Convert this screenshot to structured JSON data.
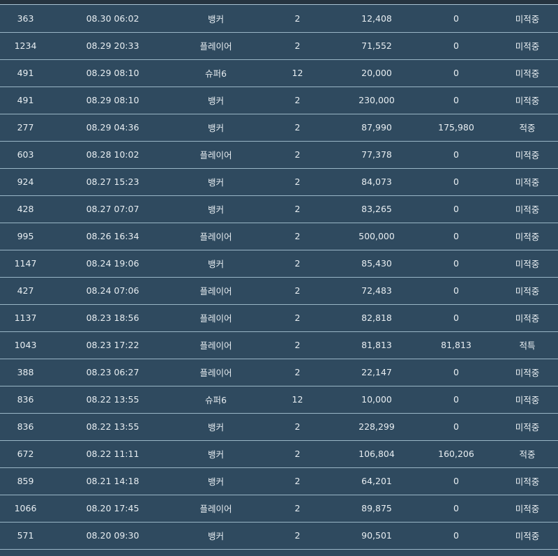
{
  "colors": {
    "background": "#2f4a5f",
    "row_divider": "#9ab6c6",
    "text": "#e8eef2",
    "result_lose": "#c8161d",
    "result_win": "#1f8a1f",
    "result_hit": "#e7b21c"
  },
  "rows": [
    {
      "id": "363",
      "time": "08.30 06:02",
      "pick": "뱅커",
      "odds": "2",
      "bet": "12,408",
      "payout": "0",
      "result": "미적중",
      "status": "lose"
    },
    {
      "id": "1234",
      "time": "08.29 20:33",
      "pick": "플레이어",
      "odds": "2",
      "bet": "71,552",
      "payout": "0",
      "result": "미적중",
      "status": "lose"
    },
    {
      "id": "491",
      "time": "08.29 08:10",
      "pick": "슈퍼6",
      "odds": "12",
      "bet": "20,000",
      "payout": "0",
      "result": "미적중",
      "status": "lose"
    },
    {
      "id": "491",
      "time": "08.29 08:10",
      "pick": "뱅커",
      "odds": "2",
      "bet": "230,000",
      "payout": "0",
      "result": "미적중",
      "status": "lose"
    },
    {
      "id": "277",
      "time": "08.29 04:36",
      "pick": "뱅커",
      "odds": "2",
      "bet": "87,990",
      "payout": "175,980",
      "result": "적중",
      "status": "win"
    },
    {
      "id": "603",
      "time": "08.28 10:02",
      "pick": "플레이어",
      "odds": "2",
      "bet": "77,378",
      "payout": "0",
      "result": "미적중",
      "status": "lose"
    },
    {
      "id": "924",
      "time": "08.27 15:23",
      "pick": "뱅커",
      "odds": "2",
      "bet": "84,073",
      "payout": "0",
      "result": "미적중",
      "status": "lose"
    },
    {
      "id": "428",
      "time": "08.27 07:07",
      "pick": "뱅커",
      "odds": "2",
      "bet": "83,265",
      "payout": "0",
      "result": "미적중",
      "status": "lose"
    },
    {
      "id": "995",
      "time": "08.26 16:34",
      "pick": "플레이어",
      "odds": "2",
      "bet": "500,000",
      "payout": "0",
      "result": "미적중",
      "status": "lose"
    },
    {
      "id": "1147",
      "time": "08.24 19:06",
      "pick": "뱅커",
      "odds": "2",
      "bet": "85,430",
      "payout": "0",
      "result": "미적중",
      "status": "lose"
    },
    {
      "id": "427",
      "time": "08.24 07:06",
      "pick": "플레이어",
      "odds": "2",
      "bet": "72,483",
      "payout": "0",
      "result": "미적중",
      "status": "lose"
    },
    {
      "id": "1137",
      "time": "08.23 18:56",
      "pick": "플레이어",
      "odds": "2",
      "bet": "82,818",
      "payout": "0",
      "result": "미적중",
      "status": "lose"
    },
    {
      "id": "1043",
      "time": "08.23 17:22",
      "pick": "플레이어",
      "odds": "2",
      "bet": "81,813",
      "payout": "81,813",
      "result": "적특",
      "status": "hit"
    },
    {
      "id": "388",
      "time": "08.23 06:27",
      "pick": "플레이어",
      "odds": "2",
      "bet": "22,147",
      "payout": "0",
      "result": "미적중",
      "status": "lose"
    },
    {
      "id": "836",
      "time": "08.22 13:55",
      "pick": "슈퍼6",
      "odds": "12",
      "bet": "10,000",
      "payout": "0",
      "result": "미적중",
      "status": "lose"
    },
    {
      "id": "836",
      "time": "08.22 13:55",
      "pick": "뱅커",
      "odds": "2",
      "bet": "228,299",
      "payout": "0",
      "result": "미적중",
      "status": "lose"
    },
    {
      "id": "672",
      "time": "08.22 11:11",
      "pick": "뱅커",
      "odds": "2",
      "bet": "106,804",
      "payout": "160,206",
      "result": "적중",
      "status": "win"
    },
    {
      "id": "859",
      "time": "08.21 14:18",
      "pick": "뱅커",
      "odds": "2",
      "bet": "64,201",
      "payout": "0",
      "result": "미적중",
      "status": "lose"
    },
    {
      "id": "1066",
      "time": "08.20 17:45",
      "pick": "플레이어",
      "odds": "2",
      "bet": "89,875",
      "payout": "0",
      "result": "미적중",
      "status": "lose"
    },
    {
      "id": "571",
      "time": "08.20 09:30",
      "pick": "뱅커",
      "odds": "2",
      "bet": "90,501",
      "payout": "0",
      "result": "미적중",
      "status": "lose"
    }
  ]
}
